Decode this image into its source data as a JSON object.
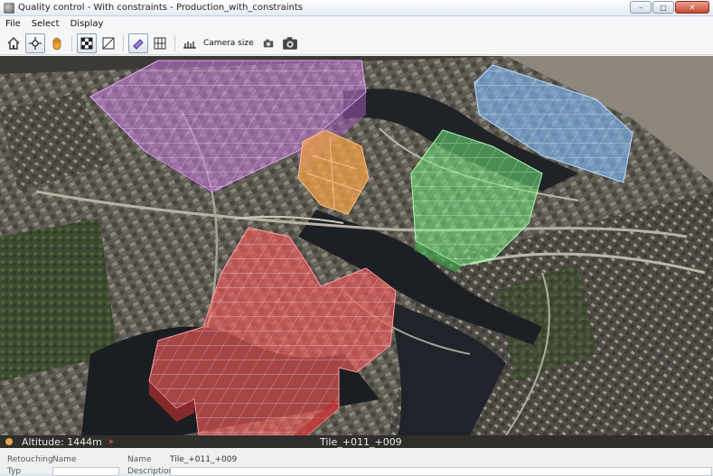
{
  "window": {
    "title": "Quality control - With constraints - Production_with_constraints",
    "controls": {
      "minimize": "–",
      "maximize": "□",
      "close": "✕"
    }
  },
  "menu": [
    "File",
    "Select",
    "Display"
  ],
  "toolbar": {
    "buttons": [
      "home-icon",
      "navigate-icon",
      "pan-hand-icon",
      "checker-icon",
      "tile-icon",
      "eraser-icon",
      "grid-icon",
      "ruler-icon"
    ],
    "camera_size_label": "Camera size"
  },
  "viewport": {
    "constraint_colors": {
      "purple": "#c77bdc",
      "orange": "#f2a24a",
      "green": "#6fe87a",
      "blue": "#7cb6ef",
      "red": "#ef5a5a"
    }
  },
  "status": {
    "altitude": "Altitude: 1444m",
    "tile": "Tile_+011_+009"
  },
  "properties": {
    "retouching_label": "Retouching",
    "retouching_name_label": "Name",
    "name_label": "Name",
    "name_value": "Tile_+011_+009",
    "type_label": "Typ",
    "description_label": "Description"
  }
}
